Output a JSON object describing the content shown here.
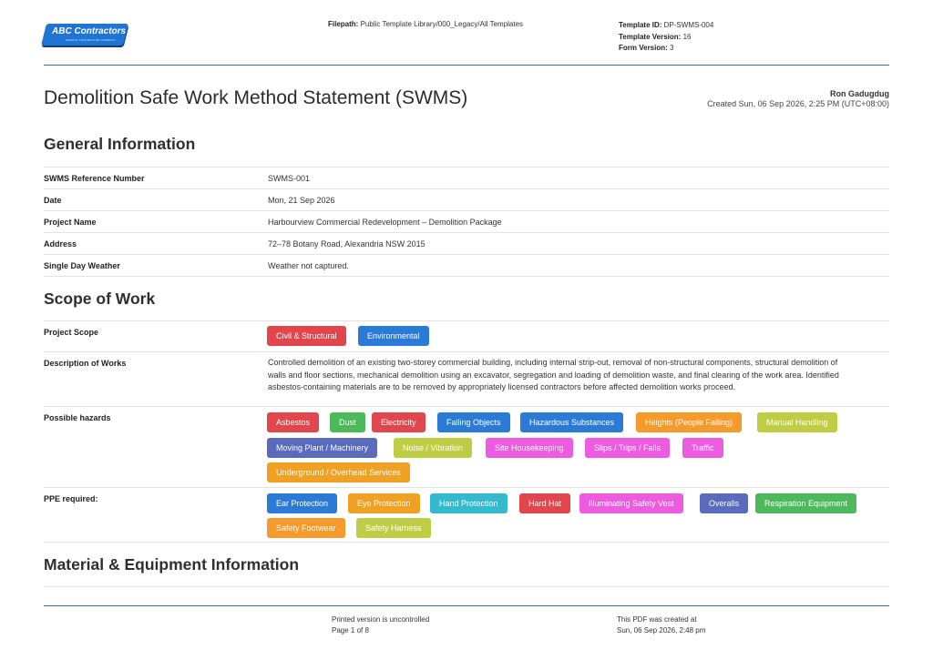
{
  "header": {
    "logo_text": "ABC Contractors",
    "logo_subtext": "SAMPLE CONTRACTOR COMPANY",
    "filepath_label": "Filepath:",
    "filepath_value": "Public Template Library/000_Legacy/All Templates",
    "template_id_label": "Template ID:",
    "template_id_value": "DP-SWMS-004",
    "template_version_label": "Template Version:",
    "template_version_value": "16",
    "form_version_label": "Form Version:",
    "form_version_value": "3"
  },
  "title": "Demolition Safe Work Method Statement (SWMS)",
  "author": {
    "name": "Ron Gadugdug",
    "created": "Created Sun, 06 Sep 2026, 2:25 PM (UTC+08:00)"
  },
  "general_information": {
    "heading": "General Information",
    "rows": [
      {
        "label": "SWMS Reference Number",
        "value": "SWMS-001"
      },
      {
        "label": "Date",
        "value": "Mon, 21 Sep 2026"
      },
      {
        "label": "Project Name",
        "value": "Harbourview Commercial Redevelopment – Demolition Package"
      },
      {
        "label": "Address",
        "value": "72–78 Botany Road, Alexandria NSW 2015"
      },
      {
        "label": "Single Day Weather",
        "value": "Weather not captured."
      }
    ]
  },
  "scope_of_work": {
    "heading": "Scope of Work",
    "project_scope_label": "Project Scope",
    "project_scope_tags": [
      {
        "label": "Civil & Structural",
        "color": "#e0464b"
      },
      {
        "label": "Environmental",
        "color": "#2b7bd6"
      }
    ],
    "description_label": "Description of Works",
    "description_lines": [
      "Controlled demolition of an existing two-storey commercial building, including internal strip-out, removal of non-structural components, structural demolition of",
      "walls and floor sections, mechanical demolition using an excavator, segregation and loading of demolition waste, and final clearing of the work area. Identified",
      "asbestos-containing materials are to be removed by appropriately licensed contractors before affected demolition works proceed."
    ],
    "hazards_label": "Possible hazards",
    "hazards": [
      {
        "label": "Asbestos",
        "color": "#e0464b"
      },
      {
        "label": "Dust",
        "color": "#4cba5b"
      },
      {
        "label": "Electricity",
        "color": "#e0464b"
      },
      {
        "label": "Falling Objects",
        "color": "#2b7bd6"
      },
      {
        "label": "Hazardous Substances",
        "color": "#2b7bd6"
      },
      {
        "label": "Heights (People Falling)",
        "color": "#f59a2b"
      },
      {
        "label": "Manual Handling",
        "color": "#bfcd45"
      },
      {
        "label": "Moving Plant / Machinery",
        "color": "#5a6bbd"
      },
      {
        "label": "Noise / Vibration",
        "color": "#bfcd45"
      },
      {
        "label": "Site Housekeeping",
        "color": "#ec5be0"
      },
      {
        "label": "Slips / Trips / Falls",
        "color": "#ec5be0"
      },
      {
        "label": "Traffic",
        "color": "#ec5be0"
      },
      {
        "label": "Underground / Overhead Services",
        "color": "#f0a022"
      }
    ],
    "ppe_label": "PPE required:",
    "ppe": [
      {
        "label": "Ear Protection",
        "color": "#2b7bd6"
      },
      {
        "label": "Eye Protection",
        "color": "#f0a022"
      },
      {
        "label": "Hand Protection",
        "color": "#35b9cf"
      },
      {
        "label": "Hard Hat",
        "color": "#e0464b"
      },
      {
        "label": "Illuminating Safety Vest",
        "color": "#ec5be0"
      },
      {
        "label": "Overalls",
        "color": "#5a6bbd"
      },
      {
        "label": "Respiration Equipment",
        "color": "#4cba5b"
      },
      {
        "label": "Safety Footwear",
        "color": "#f59a2b"
      },
      {
        "label": "Safety Harness",
        "color": "#bfcd45"
      }
    ]
  },
  "material_equipment": {
    "heading": "Material & Equipment Information"
  },
  "footer": {
    "uncontrolled": "Printed version is uncontrolled",
    "page": "Page 1 of 8",
    "pdf_created_label": "This PDF was created at",
    "pdf_created_value": "Sun, 06 Sep 2026, 2:48 pm"
  }
}
